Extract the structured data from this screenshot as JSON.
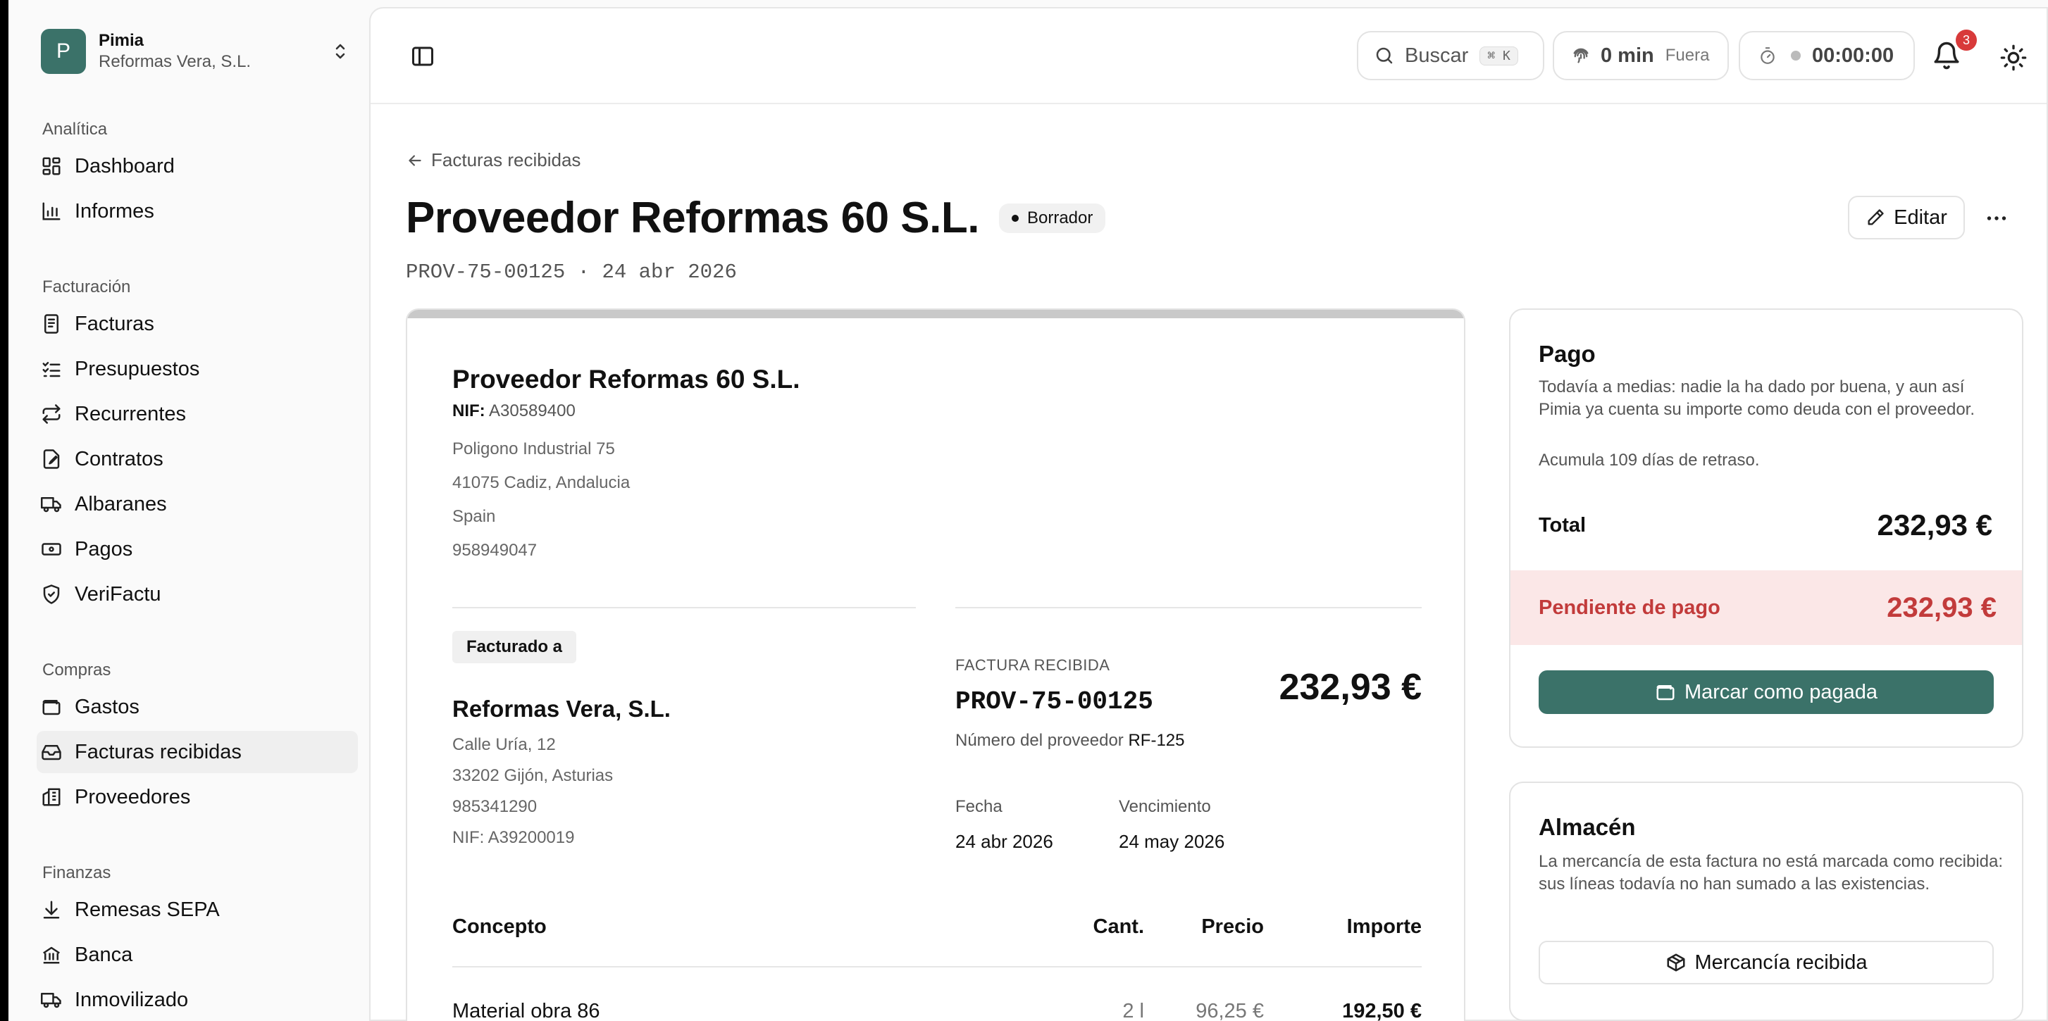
{
  "org": {
    "initial": "P",
    "name": "Pimia",
    "company": "Reformas Vera, S.L."
  },
  "sidebar": {
    "sections": [
      {
        "heading": "Analítica",
        "items": [
          {
            "label": "Dashboard",
            "icon": "dashboard-icon"
          },
          {
            "label": "Informes",
            "icon": "bar-chart-icon"
          }
        ]
      },
      {
        "heading": "Facturación",
        "items": [
          {
            "label": "Facturas",
            "icon": "invoice-icon"
          },
          {
            "label": "Presupuestos",
            "icon": "checklist-icon"
          },
          {
            "label": "Recurrentes",
            "icon": "repeat-icon"
          },
          {
            "label": "Contratos",
            "icon": "contract-icon"
          },
          {
            "label": "Albaranes",
            "icon": "truck-icon"
          },
          {
            "label": "Pagos",
            "icon": "banknote-icon"
          },
          {
            "label": "VeriFactu",
            "icon": "shield-check-icon"
          }
        ]
      },
      {
        "heading": "Compras",
        "items": [
          {
            "label": "Gastos",
            "icon": "wallet-icon"
          },
          {
            "label": "Facturas recibidas",
            "icon": "inbox-icon",
            "active": true
          },
          {
            "label": "Proveedores",
            "icon": "building-icon"
          }
        ]
      },
      {
        "heading": "Finanzas",
        "items": [
          {
            "label": "Remesas SEPA",
            "icon": "download-icon"
          },
          {
            "label": "Banca",
            "icon": "bank-icon"
          },
          {
            "label": "Inmovilizado",
            "icon": "truck-icon"
          }
        ]
      }
    ]
  },
  "topbar": {
    "search_label": "Buscar",
    "search_shortcut": "⌘ K",
    "time_value": "0 min",
    "time_status": "Fuera",
    "timer_value": "00:00:00",
    "notifications_count": "3"
  },
  "page": {
    "back_label": "Facturas recibidas",
    "title": "Proveedor Reformas 60 S.L.",
    "status": "Borrador",
    "subline": "PROV-75-00125 · 24 abr 2026",
    "edit_label": "Editar"
  },
  "invoice": {
    "supplier": {
      "name": "Proveedor Reformas 60 S.L.",
      "nif_label": "NIF:",
      "nif": "A30589400",
      "address1": "Poligono Industrial 75",
      "address2": "41075 Cadiz, Andalucia",
      "country": "Spain",
      "phone": "958949047"
    },
    "billed_to_label": "Facturado a",
    "client": {
      "name": "Reformas Vera, S.L.",
      "address1": "Calle Uría, 12",
      "address2": "33202 Gijón, Asturias",
      "phone": "985341290",
      "nif": "NIF: A39200019"
    },
    "type_label": "FACTURA RECIBIDA",
    "number": "PROV-75-00125",
    "total": "232,93 €",
    "provider_number_label": "Número del proveedor",
    "provider_number": "RF-125",
    "date_label": "Fecha",
    "date": "24 abr 2026",
    "due_label": "Vencimiento",
    "due": "24 may 2026",
    "table": {
      "headers": {
        "concept": "Concepto",
        "qty": "Cant.",
        "price": "Precio",
        "amount": "Importe"
      },
      "rows": [
        {
          "concept": "Material obra 86",
          "qty": "2 l",
          "price": "96,25 €",
          "amount": "192,50 €"
        }
      ]
    }
  },
  "payment": {
    "title": "Pago",
    "description": "Todavía a medias: nadie la ha dado por buena, y aun así Pimia ya cuenta su importe como deuda con el proveedor.",
    "delay_note": "Acumula 109 días de retraso.",
    "total_label": "Total",
    "total": "232,93 €",
    "pending_label": "Pendiente de pago",
    "pending": "232,93 €",
    "button_label": "Marcar como pagada",
    "accent": "#3b7269",
    "danger": "#c23b3b"
  },
  "warehouse": {
    "title": "Almacén",
    "description": "La mercancía de esta factura no está marcada como recibida: sus líneas todavía no han sumado a las existencias.",
    "button_label": "Mercancía recibida"
  }
}
